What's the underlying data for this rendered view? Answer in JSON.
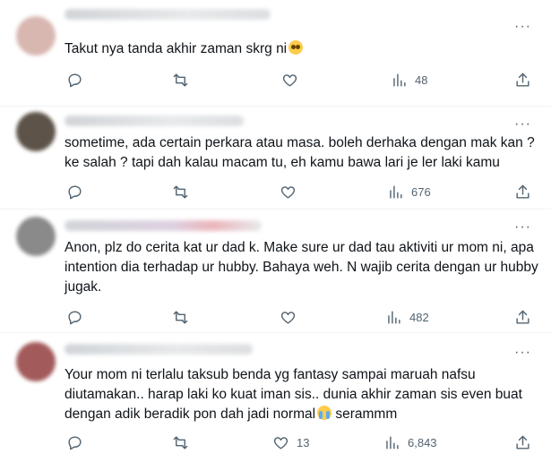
{
  "tweets": [
    {
      "text": "Takut nya tanda akhir zaman skrg ni",
      "emoji": "pleading-face",
      "stats": {
        "replies": "",
        "retweets": "",
        "likes": "",
        "views": "48"
      },
      "avatar_color": "#d8b7b0"
    },
    {
      "text": "sometime, ada certain perkara atau masa. boleh derhaka dengan mak kan ? ke salah ? tapi dah kalau macam tu, eh kamu bawa lari je ler laki kamu",
      "stats": {
        "replies": "",
        "retweets": "",
        "likes": "",
        "views": "676"
      },
      "avatar_color": "#5d5348"
    },
    {
      "text": "Anon, plz do cerita kat ur dad k. Make sure ur dad tau aktiviti ur mom ni, apa intention dia terhadap ur hubby. Bahaya weh. N wajib cerita dengan ur hubby jugak.",
      "stats": {
        "replies": "",
        "retweets": "",
        "likes": "",
        "views": "482"
      },
      "avatar_color": "#8a8a8a"
    },
    {
      "text": "Your mom ni terlalu taksub benda yg fantasy sampai maruah nafsu diutamakan.. harap laki ko kuat iman sis.. dunia akhir zaman sis even buat dengan adik beradik pon dah jadi normal",
      "text_suffix": " serammm",
      "emoji": "crying-face",
      "stats": {
        "replies": "",
        "retweets": "",
        "likes": "13",
        "views": "6,843"
      },
      "avatar_color": "#a35a5a"
    }
  ],
  "icons": {
    "reply": "reply-icon",
    "retweet": "retweet-icon",
    "like": "heart-icon",
    "views": "views-icon",
    "share": "share-icon",
    "more": "more-icon"
  },
  "more_label": "···"
}
